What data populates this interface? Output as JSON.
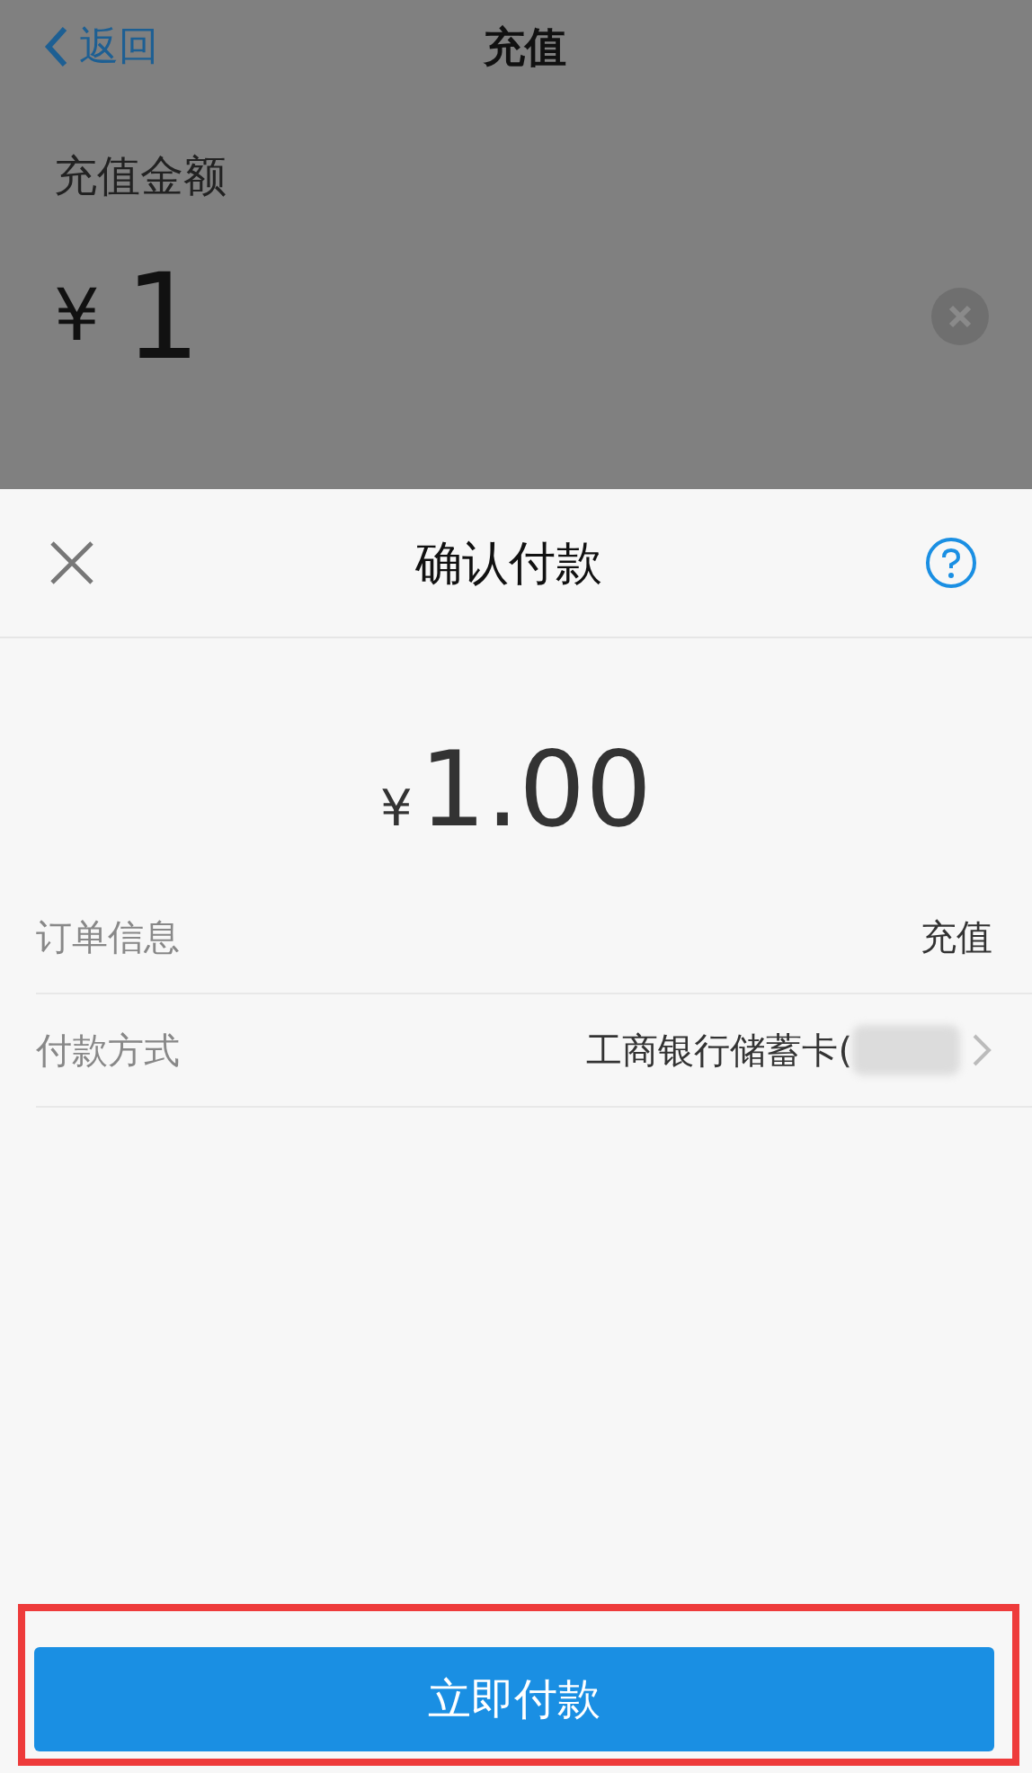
{
  "nav_bar": {
    "back": "返回",
    "title": "充值"
  },
  "recharge": {
    "label": "充值金额",
    "currency": "¥",
    "value": "1"
  },
  "sheet": {
    "title": "确认付款",
    "amount_currency": "¥",
    "amount": "1.00",
    "rows": [
      {
        "label": "订单信息",
        "value": "充值",
        "kind": "plain"
      },
      {
        "label": "付款方式",
        "value": "工商银行储蓄卡(",
        "kind": "link"
      }
    ],
    "pay_button": "立即付款",
    "highlighted": true
  }
}
